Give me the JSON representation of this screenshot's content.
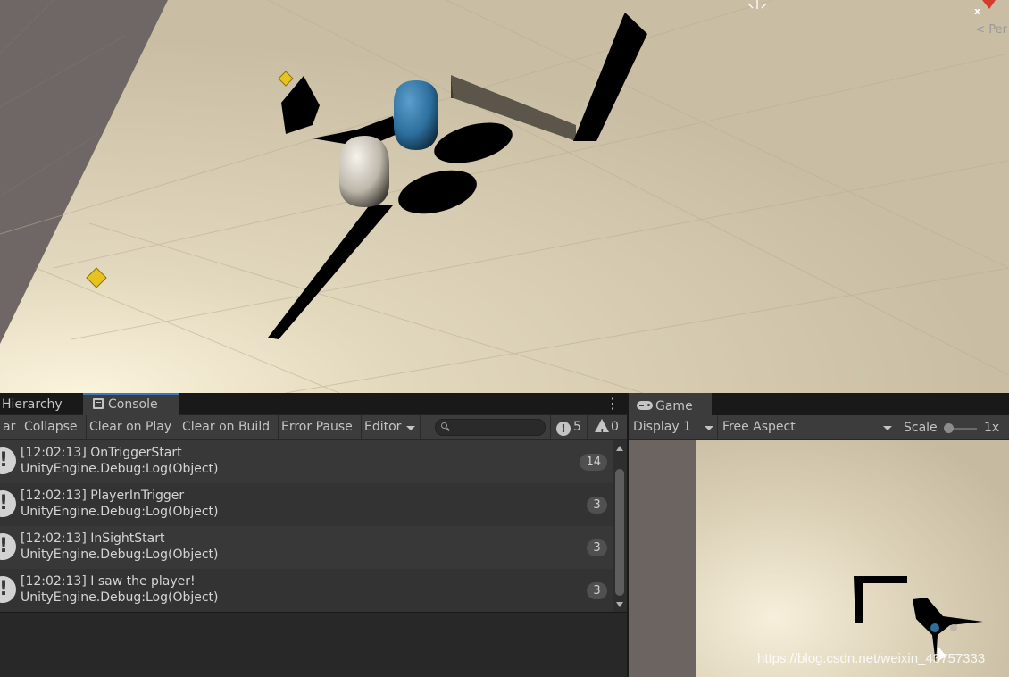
{
  "scene": {
    "persp_label": "Per",
    "close_label": "x"
  },
  "console": {
    "tabs": [
      {
        "label": "Hierarchy",
        "active": false
      },
      {
        "label": "Console",
        "active": true
      }
    ],
    "menu_icon": "kebab-menu-icon",
    "toolbar": {
      "clear": "ar",
      "collapse": "Collapse",
      "clear_on_play": "Clear on Play",
      "clear_on_build": "Clear on Build",
      "error_pause": "Error Pause",
      "editor": "Editor",
      "search_placeholder": "",
      "log_count": "5",
      "warning_count": "0"
    },
    "logs": [
      {
        "time_msg": "[12:02:13] OnTriggerStart",
        "source": "UnityEngine.Debug:Log(Object)",
        "count": "14"
      },
      {
        "time_msg": "[12:02:13] PlayerInTrigger",
        "source": "UnityEngine.Debug:Log(Object)",
        "count": "3"
      },
      {
        "time_msg": "[12:02:13] InSightStart",
        "source": "UnityEngine.Debug:Log(Object)",
        "count": "3"
      },
      {
        "time_msg": "[12:02:13] I saw the player!",
        "source": "UnityEngine.Debug:Log(Object)",
        "count": "3"
      }
    ]
  },
  "game": {
    "tab_label": "Game",
    "display": "Display 1",
    "aspect": "Free Aspect",
    "scale_label": "Scale",
    "scale_value": "1x",
    "scale_fraction": 0.0
  },
  "watermark": "https://blog.csdn.net/weixin_43757333",
  "colors": {
    "tab_accent": "#3a79bb",
    "panel_bg": "#282828",
    "toolbar_bg": "#3c3c3c",
    "ground": "#cdc2a6",
    "player_blue": "#2c6e9c"
  }
}
